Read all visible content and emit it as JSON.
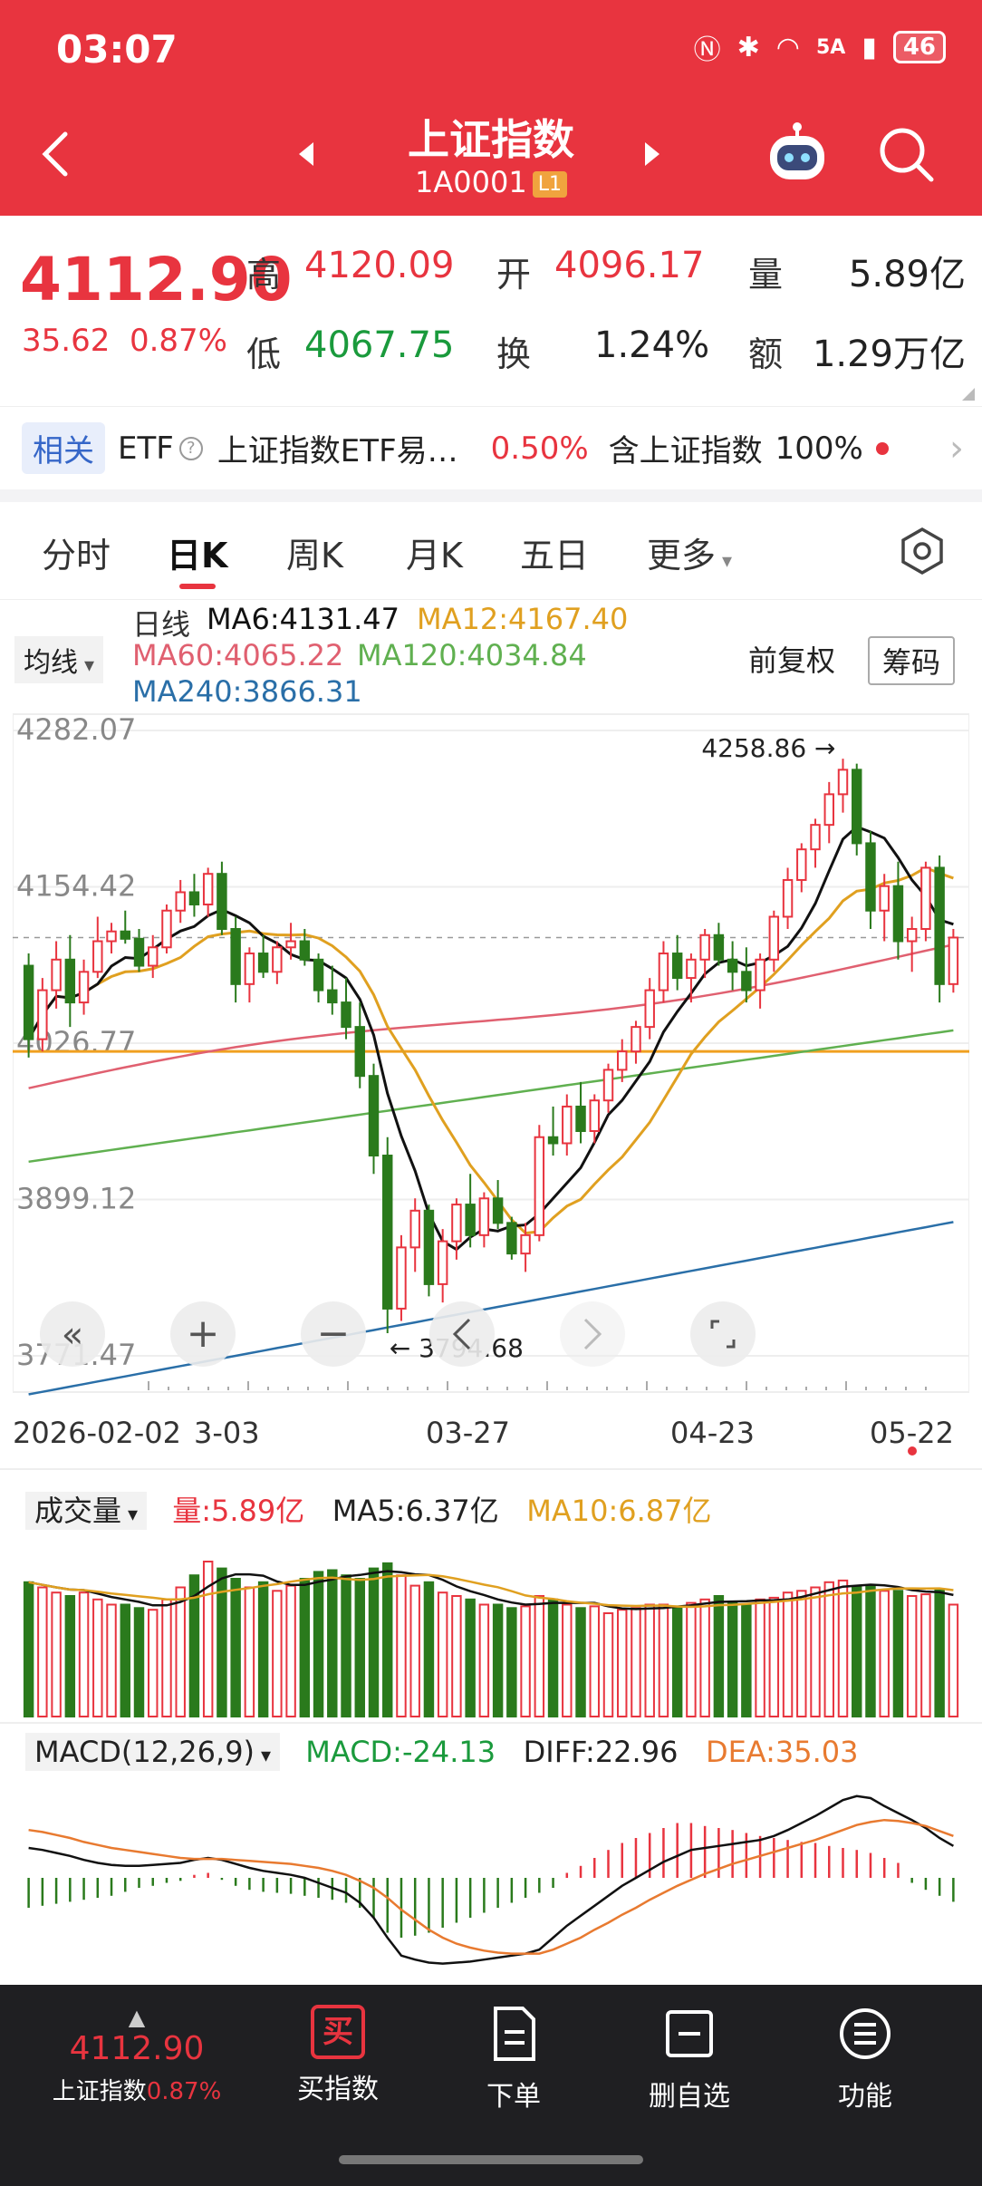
{
  "status": {
    "time": "03:07",
    "network": "5A",
    "battery": "46"
  },
  "header": {
    "title": "上证指数",
    "code": "1A0001",
    "level_badge": "L1"
  },
  "quote": {
    "price": "4112.90",
    "change": "35.62",
    "change_pct": "0.87%",
    "high_label": "高",
    "high": "4120.09",
    "open_label": "开",
    "open": "4096.17",
    "volume_label": "量",
    "volume": "5.89亿",
    "low_label": "低",
    "low": "4067.75",
    "turnover_label": "换",
    "turnover": "1.24%",
    "amount_label": "额",
    "amount": "1.29万亿"
  },
  "related": {
    "tag": "相关",
    "type": "ETF",
    "name": "上证指数ETF易…",
    "pct": "0.50%",
    "contain_label": "含上证指数",
    "contain_pct": "100%"
  },
  "tabs": [
    "分时",
    "日K",
    "周K",
    "月K",
    "五日",
    "更多"
  ],
  "active_tab": "日K",
  "ma_legend": {
    "selector": "均线",
    "period": "日线",
    "ma6": "MA6:4131.47",
    "ma12": "MA12:4167.40",
    "ma60": "MA60:4065.22",
    "ma120": "MA120:4034.84",
    "ma240": "MA240:3866.31",
    "adjust": "前复权",
    "chips": "筹码"
  },
  "colors": {
    "up": "#e8343f",
    "down": "#2a7a1c",
    "ma6": "#111111",
    "ma12": "#e0a020",
    "ma60": "#e06070",
    "ma120": "#60b050",
    "ma240": "#2a6fa8",
    "ref_line": "#f0a020"
  },
  "chart_data": {
    "type": "candlestick",
    "y_ticks": [
      "4282.07",
      "4154.42",
      "4026.77",
      "3899.12",
      "3771.47"
    ],
    "ylim": [
      3771.47,
      4282.07
    ],
    "high_marker": "4258.86",
    "low_marker": "3794.68",
    "x_ticks": [
      "2026-02-02",
      "3-03",
      "03-27",
      "04-23",
      "05-22"
    ],
    "reference_level": 4020,
    "ohlc": [
      [
        4090,
        4100,
        4015,
        4030
      ],
      [
        4030,
        4080,
        4020,
        4070
      ],
      [
        4070,
        4110,
        4055,
        4095
      ],
      [
        4095,
        4115,
        4040,
        4060
      ],
      [
        4060,
        4095,
        4050,
        4085
      ],
      [
        4085,
        4130,
        4080,
        4110
      ],
      [
        4110,
        4125,
        4100,
        4118
      ],
      [
        4118,
        4135,
        4108,
        4112
      ],
      [
        4112,
        4120,
        4085,
        4090
      ],
      [
        4090,
        4115,
        4080,
        4105
      ],
      [
        4105,
        4140,
        4100,
        4135
      ],
      [
        4135,
        4160,
        4125,
        4150
      ],
      [
        4150,
        4165,
        4130,
        4140
      ],
      [
        4140,
        4170,
        4130,
        4165
      ],
      [
        4165,
        4175,
        4115,
        4120
      ],
      [
        4120,
        4130,
        4060,
        4075
      ],
      [
        4075,
        4105,
        4060,
        4100
      ],
      [
        4100,
        4115,
        4080,
        4085
      ],
      [
        4085,
        4110,
        4075,
        4105
      ],
      [
        4105,
        4125,
        4095,
        4110
      ],
      [
        4110,
        4120,
        4090,
        4095
      ],
      [
        4095,
        4100,
        4060,
        4070
      ],
      [
        4070,
        4090,
        4050,
        4060
      ],
      [
        4060,
        4080,
        4030,
        4040
      ],
      [
        4040,
        4060,
        3990,
        4000
      ],
      [
        4000,
        4010,
        3920,
        3935
      ],
      [
        3935,
        3950,
        3790,
        3810
      ],
      [
        3810,
        3870,
        3800,
        3860
      ],
      [
        3860,
        3900,
        3840,
        3890
      ],
      [
        3890,
        3895,
        3820,
        3830
      ],
      [
        3830,
        3875,
        3815,
        3865
      ],
      [
        3865,
        3900,
        3850,
        3895
      ],
      [
        3895,
        3920,
        3860,
        3870
      ],
      [
        3870,
        3905,
        3860,
        3900
      ],
      [
        3900,
        3915,
        3875,
        3880
      ],
      [
        3880,
        3885,
        3850,
        3855
      ],
      [
        3855,
        3880,
        3840,
        3870
      ],
      [
        3870,
        3960,
        3865,
        3950
      ],
      [
        3950,
        3975,
        3935,
        3945
      ],
      [
        3945,
        3985,
        3935,
        3975
      ],
      [
        3975,
        3995,
        3945,
        3955
      ],
      [
        3955,
        3985,
        3945,
        3980
      ],
      [
        3980,
        4010,
        3970,
        4005
      ],
      [
        4005,
        4030,
        3995,
        4020
      ],
      [
        4020,
        4045,
        4010,
        4040
      ],
      [
        4040,
        4080,
        4030,
        4070
      ],
      [
        4070,
        4110,
        4060,
        4100
      ],
      [
        4100,
        4115,
        4070,
        4080
      ],
      [
        4080,
        4100,
        4060,
        4095
      ],
      [
        4095,
        4120,
        4080,
        4115
      ],
      [
        4115,
        4125,
        4090,
        4095
      ],
      [
        4095,
        4110,
        4070,
        4085
      ],
      [
        4085,
        4105,
        4060,
        4070
      ],
      [
        4070,
        4100,
        4055,
        4095
      ],
      [
        4095,
        4135,
        4085,
        4130
      ],
      [
        4130,
        4170,
        4120,
        4160
      ],
      [
        4160,
        4190,
        4150,
        4185
      ],
      [
        4185,
        4210,
        4170,
        4205
      ],
      [
        4205,
        4240,
        4190,
        4230
      ],
      [
        4230,
        4259,
        4215,
        4250
      ],
      [
        4250,
        4255,
        4180,
        4190
      ],
      [
        4190,
        4200,
        4120,
        4135
      ],
      [
        4135,
        4165,
        4110,
        4155
      ],
      [
        4155,
        4175,
        4095,
        4110
      ],
      [
        4110,
        4130,
        4085,
        4120
      ],
      [
        4120,
        4175,
        4110,
        4170
      ],
      [
        4170,
        4180,
        4060,
        4075
      ],
      [
        4075,
        4120,
        4068,
        4113
      ]
    ],
    "volume": {
      "labels": {
        "selector": "成交量",
        "vol": "量:5.89亿",
        "ma5": "MA5:6.37亿",
        "ma10": "MA10:6.87亿"
      },
      "values": [
        7.8,
        7.5,
        7.2,
        7.0,
        7.2,
        6.8,
        6.5,
        6.5,
        6.3,
        6.2,
        6.8,
        7.5,
        8.2,
        9.0,
        8.6,
        8.0,
        7.5,
        7.8,
        7.3,
        7.6,
        8.0,
        8.4,
        8.5,
        8.2,
        8.0,
        8.6,
        8.9,
        8.2,
        7.6,
        7.8,
        7.2,
        7.0,
        6.8,
        6.5,
        6.5,
        6.3,
        6.4,
        7.0,
        6.8,
        6.5,
        6.3,
        6.4,
        6.0,
        6.2,
        6.3,
        6.5,
        6.5,
        6.4,
        6.6,
        6.8,
        7.0,
        6.6,
        6.5,
        6.8,
        6.9,
        7.2,
        7.3,
        7.5,
        7.8,
        7.9,
        7.5,
        7.6,
        7.3,
        7.3,
        7.0,
        7.1,
        7.4,
        6.5
      ]
    },
    "macd": {
      "labels": {
        "selector": "MACD(12,26,9)",
        "macd": "MACD:-24.13",
        "diff": "DIFF:22.96",
        "dea": "DEA:35.03"
      },
      "hist": [
        -30,
        -28,
        -26,
        -24,
        -22,
        -20,
        -18,
        -14,
        -10,
        -8,
        -5,
        -3,
        3,
        5,
        -2,
        -8,
        -12,
        -14,
        -15,
        -16,
        -18,
        -20,
        -22,
        -25,
        -30,
        -40,
        -55,
        -60,
        -58,
        -55,
        -50,
        -45,
        -40,
        -35,
        -30,
        -25,
        -20,
        -15,
        -10,
        5,
        12,
        20,
        28,
        35,
        40,
        45,
        50,
        55,
        55,
        52,
        50,
        48,
        45,
        42,
        40,
        38,
        36,
        35,
        32,
        30,
        28,
        25,
        20,
        15,
        -5,
        -12,
        -18,
        -24
      ],
      "diff": [
        30,
        28,
        25,
        22,
        18,
        15,
        13,
        12,
        12,
        13,
        14,
        15,
        18,
        20,
        18,
        14,
        10,
        7,
        5,
        3,
        0,
        -5,
        -10,
        -15,
        -25,
        -40,
        -60,
        -78,
        -82,
        -85,
        -86,
        -85,
        -84,
        -82,
        -80,
        -78,
        -76,
        -72,
        -60,
        -48,
        -38,
        -28,
        -18,
        -8,
        0,
        8,
        16,
        22,
        28,
        30,
        32,
        34,
        36,
        38,
        42,
        48,
        55,
        62,
        70,
        78,
        82,
        80,
        72,
        65,
        58,
        50,
        40,
        32
      ],
      "dea": [
        48,
        46,
        43,
        40,
        36,
        33,
        30,
        28,
        26,
        24,
        22,
        20,
        19,
        19,
        19,
        18,
        17,
        16,
        15,
        14,
        12,
        10,
        7,
        3,
        -3,
        -10,
        -20,
        -32,
        -42,
        -52,
        -60,
        -66,
        -70,
        -73,
        -75,
        -76,
        -76,
        -76,
        -72,
        -66,
        -60,
        -52,
        -45,
        -37,
        -30,
        -22,
        -15,
        -8,
        -2,
        4,
        9,
        14,
        18,
        22,
        26,
        30,
        34,
        38,
        43,
        48,
        53,
        56,
        58,
        57,
        55,
        52,
        47,
        42
      ]
    }
  },
  "bottom_bar": {
    "index_price": "4112.90",
    "index_name": "上证指数",
    "index_pct": "0.87%",
    "buy": "买指数",
    "order": "下单",
    "remove_watch": "删自选",
    "functions": "功能",
    "buy_icon_char": "买"
  }
}
